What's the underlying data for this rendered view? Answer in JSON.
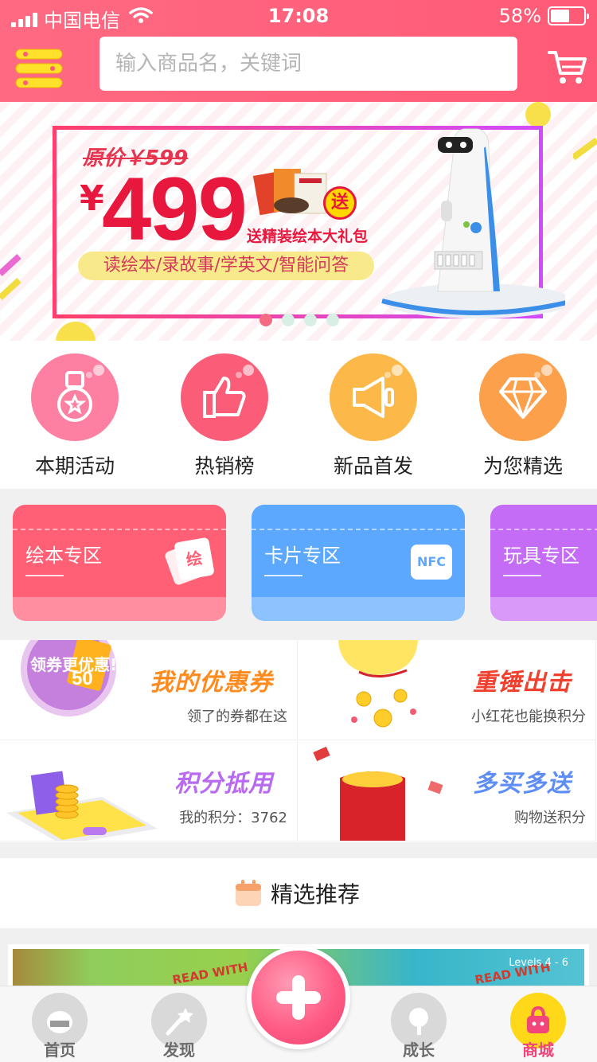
{
  "status": {
    "carrier": "中国电信",
    "time": "17:08",
    "battery": "58%",
    "battery_level": 0.58
  },
  "search": {
    "placeholder": "输入商品名，关键词"
  },
  "banner": {
    "original_price": "原价￥599",
    "currency": "¥",
    "price": "499",
    "gift_badge": "送",
    "gift_text": "送精装绘本大礼包",
    "features": "读绘本/录故事/学英文/智能问答",
    "slides": 4,
    "active_slide": 0
  },
  "quick": [
    {
      "label": "本期活动",
      "color": "#fd7fa1",
      "icon": "medal-icon"
    },
    {
      "label": "热销榜",
      "color": "#fb5d79",
      "icon": "thumbs-up-icon"
    },
    {
      "label": "新品首发",
      "color": "#fdb84a",
      "icon": "megaphone-icon"
    },
    {
      "label": "为您精选",
      "color": "#fca04c",
      "icon": "diamond-icon"
    }
  ],
  "zones": [
    {
      "label": "绘本专区",
      "color": "#ff6076",
      "bottom": "#ff8fa0",
      "badge": "绘"
    },
    {
      "label": "卡片专区",
      "color": "#5ca8ff",
      "bottom": "#8cc3ff",
      "badge": "NFC"
    },
    {
      "label": "玩具专区",
      "color": "#c46cf5",
      "bottom": "#d899f8",
      "badge": ""
    }
  ],
  "promo": [
    {
      "title": "我的优惠券",
      "subtitle": "领了的券都在这",
      "color": "#ff8b1f",
      "art_text": "领券更优惠!",
      "art_num": "50"
    },
    {
      "title": "重锤出击",
      "subtitle": "小红花也能换积分",
      "color": "#f0412f"
    },
    {
      "title": "积分抵用",
      "subtitle": "我的积分：3762",
      "color": "#b86af0"
    },
    {
      "title": "多买多送",
      "subtitle": "购物送积分",
      "color": "#5d8df5"
    }
  ],
  "section": {
    "title": "精选推荐"
  },
  "product": {
    "badge_text": "READ WITH",
    "levels": "Levels 4 - 6"
  },
  "tabs": [
    {
      "label": "首页",
      "icon": "home-icon"
    },
    {
      "label": "发现",
      "icon": "discover-icon"
    },
    {
      "label": "成长",
      "icon": "growth-icon"
    },
    {
      "label": "商城",
      "icon": "mall-icon",
      "active": true
    }
  ]
}
